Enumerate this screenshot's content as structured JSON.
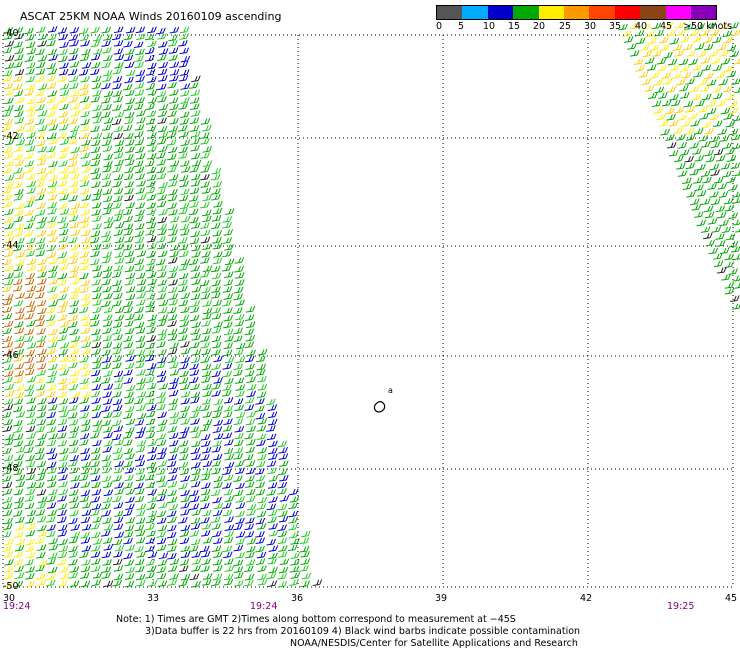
{
  "title": "ASCAT 25KM NOAA Winds 20160109 ascending",
  "legend": {
    "colors": [
      "#555555",
      "#00aaff",
      "#0000cc",
      "#00aa00",
      "#ffee00",
      "#ff9900",
      "#ff4400",
      "#ff0000",
      "#8b4513",
      "#ff00ff",
      "#8800bb"
    ],
    "labels": [
      "0",
      "5",
      "10",
      "15",
      "20",
      "25",
      "30",
      "35",
      "40",
      "45",
      ">50 knots"
    ]
  },
  "map": {
    "lat_labels": [
      "-40",
      "-42",
      "-44",
      "-46",
      "-48",
      "-50"
    ],
    "lon_labels": [
      "30",
      "33",
      "36",
      "39",
      "42",
      "45"
    ],
    "time_labels": [
      "19:24",
      "19:24",
      "19:25"
    ],
    "island_label": "a"
  },
  "notes": {
    "line1": "Note: 1) Times are GMT 2)Times along bottom correspond to measurement at −45S",
    "line2": "3)Data buffer is 22 hrs from 20160109 4) Black wind barbs indicate possible contamination",
    "line3": "NOAA/NESDIS/Center for Satellite Applications and Research"
  }
}
